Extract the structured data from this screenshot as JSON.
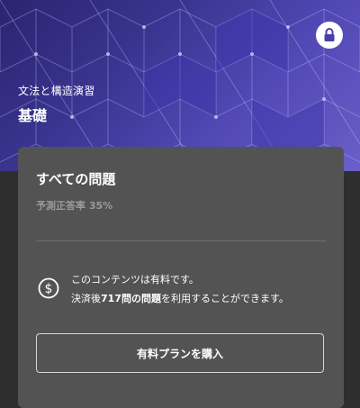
{
  "header": {
    "subtitle": "文法と構造演習",
    "title": "基礎",
    "lock_icon": "lock-icon",
    "accent_color": "#4a3fa8"
  },
  "card": {
    "title": "すべての問題",
    "predicted_rate": "予測正答率 35%",
    "paid_notice_line1": "このコンテンツは有料です。",
    "paid_notice_prefix": "決済後",
    "paid_notice_count": "717問",
    "paid_notice_bold_suffix": "の問題",
    "paid_notice_suffix": "を利用することができます。",
    "notice_icon": "dollar-circle-icon",
    "buy_button_label": "有料プランを購入"
  }
}
